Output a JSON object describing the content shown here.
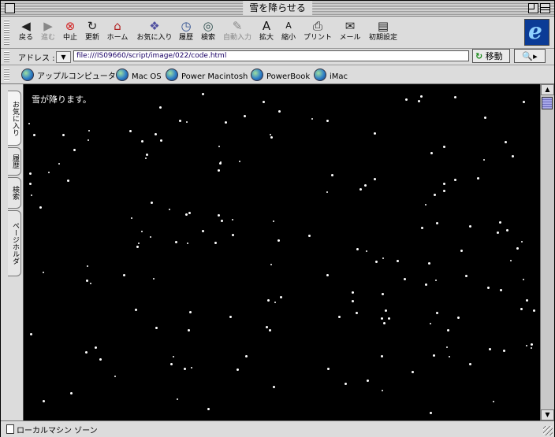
{
  "window": {
    "title": "雪を降らせる"
  },
  "toolbar": {
    "buttons": [
      {
        "label": "戻る",
        "icon": "◀",
        "icon_name": "back-arrow-icon",
        "color": "#222222"
      },
      {
        "label": "進む",
        "icon": "▶",
        "icon_name": "forward-arrow-icon",
        "color": "#888888"
      },
      {
        "label": "中止",
        "icon": "⊗",
        "icon_name": "stop-icon",
        "color": "#d22222"
      },
      {
        "label": "更新",
        "icon": "↻",
        "icon_name": "refresh-icon",
        "color": "#222222"
      },
      {
        "label": "ホーム",
        "icon": "⌂",
        "icon_name": "home-icon",
        "color": "#b02020"
      },
      {
        "label": "お気に入り",
        "icon": "❖",
        "icon_name": "favorites-icon",
        "color": "#5050a0"
      },
      {
        "label": "履歴",
        "icon": "◷",
        "icon_name": "history-icon",
        "color": "#305090"
      },
      {
        "label": "検索",
        "icon": "◎",
        "icon_name": "search-icon",
        "color": "#305050"
      },
      {
        "label": "自動入力",
        "icon": "✎",
        "icon_name": "autofill-icon",
        "color": "#888888"
      },
      {
        "label": "拡大",
        "icon": "A",
        "icon_name": "larger-text-icon",
        "color": "#111111"
      },
      {
        "label": "縮小",
        "icon": "A",
        "icon_name": "smaller-text-icon",
        "color": "#111111"
      },
      {
        "label": "プリント",
        "icon": "⎙",
        "icon_name": "print-icon",
        "color": "#222222"
      },
      {
        "label": "メール",
        "icon": "✉",
        "icon_name": "mail-icon",
        "color": "#222222"
      },
      {
        "label": "初期設定",
        "icon": "▤",
        "icon_name": "preferences-icon",
        "color": "#222222"
      }
    ],
    "logo_letter": "e"
  },
  "address": {
    "label": "アドレス :",
    "dropdown": "▼",
    "url": "file:///IS09660/script/image/022/code.html",
    "go_label": "移動",
    "go_icon": "↻",
    "search_icon": "🔍"
  },
  "favorites": {
    "items": [
      "アップルコンピュータ",
      "Mac OS",
      "Power Macintosh",
      "PowerBook",
      "iMac"
    ]
  },
  "sidetabs": {
    "items": [
      "お気に入り",
      "履歴",
      "検索",
      "ページホルダ"
    ]
  },
  "content": {
    "text": "雪が降ります。",
    "background_color": "#000000",
    "flake_color": "#ffffff"
  },
  "scrollbar": {
    "up": "▲",
    "down": "▼"
  },
  "status": {
    "text": "ローカルマシン ゾーン"
  }
}
